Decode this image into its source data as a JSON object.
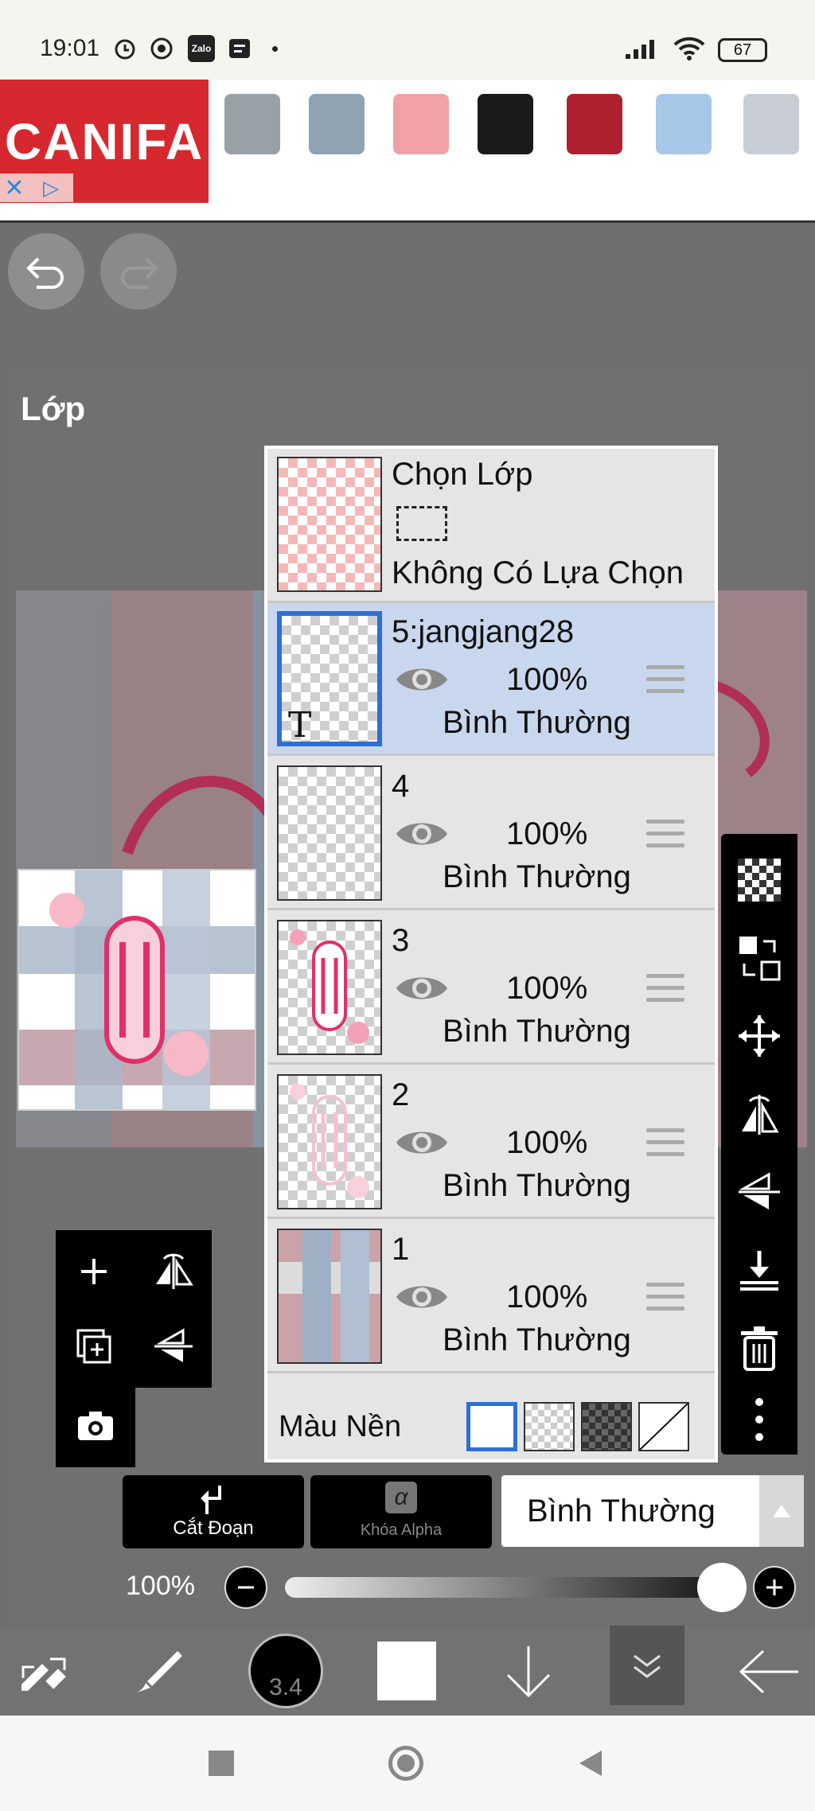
{
  "status_bar": {
    "time": "19:01",
    "zalo_label": "Zalo",
    "battery": "67"
  },
  "ad": {
    "brand": "CANIFA",
    "close_glyph": "✕",
    "choices_glyph": "▷",
    "product_colors": [
      "#9aa0a8",
      "#8fa3b0",
      "#f2a0a8",
      "#1a1a1a",
      "#b0202e",
      "#a8c8ea",
      "#c8ccd4"
    ]
  },
  "panel": {
    "title": "Lớp"
  },
  "selection_row": {
    "title": "Chọn Lớp",
    "subtitle": "Không Có Lựa Chọn"
  },
  "layers": [
    {
      "name": "5:jangjang28",
      "opacity": "100%",
      "blend": "Bình Thường",
      "selected": true,
      "type_badge": "T"
    },
    {
      "name": "4",
      "opacity": "100%",
      "blend": "Bình Thường",
      "selected": false
    },
    {
      "name": "3",
      "opacity": "100%",
      "blend": "Bình Thường",
      "selected": false
    },
    {
      "name": "2",
      "opacity": "100%",
      "blend": "Bình Thường",
      "selected": false
    },
    {
      "name": "1",
      "opacity": "100%",
      "blend": "Bình Thường",
      "selected": false
    }
  ],
  "background_row": {
    "label": "Màu Nền"
  },
  "actions": {
    "clip_label": "Cắt Đoạn",
    "alpha_lock_label": "Khóa Alpha",
    "blend_mode": "Bình Thường",
    "alpha_glyph": "α"
  },
  "opacity_control": {
    "label": "100%",
    "value": 1.0
  },
  "bottom_toolbar": {
    "brush_size": "3.4"
  },
  "colors": {
    "accent": "#2e6fd6",
    "selected_row": "#c9d7ee",
    "art_pink": "#e0306a"
  }
}
